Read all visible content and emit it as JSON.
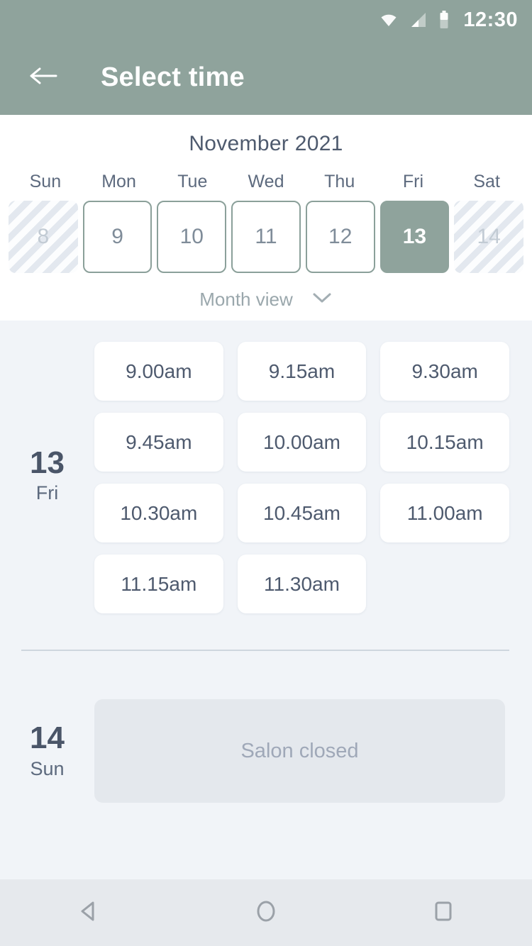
{
  "statusbar": {
    "time": "12:30",
    "icons": [
      "wifi-icon",
      "cellular-signal-icon",
      "battery-icon"
    ]
  },
  "appbar": {
    "back_icon": "back-arrow-icon",
    "title": "Select time"
  },
  "calendar": {
    "month_title": "November 2021",
    "weekdays": [
      "Sun",
      "Mon",
      "Tue",
      "Wed",
      "Thu",
      "Fri",
      "Sat"
    ],
    "days": [
      {
        "label": "8",
        "state": "disabled"
      },
      {
        "label": "9",
        "state": "available"
      },
      {
        "label": "10",
        "state": "available"
      },
      {
        "label": "11",
        "state": "available"
      },
      {
        "label": "12",
        "state": "available"
      },
      {
        "label": "13",
        "state": "selected"
      },
      {
        "label": "14",
        "state": "disabled"
      }
    ],
    "view_toggle": {
      "label": "Month view",
      "icon": "chevron-down-icon"
    }
  },
  "schedule": {
    "days": [
      {
        "date_number": "13",
        "weekday": "Fri",
        "slots": [
          "9.00am",
          "9.15am",
          "9.30am",
          "9.45am",
          "10.00am",
          "10.15am",
          "10.30am",
          "10.45am",
          "11.00am",
          "11.15am",
          "11.30am"
        ]
      },
      {
        "date_number": "14",
        "weekday": "Sun",
        "closed_message": "Salon closed"
      }
    ]
  },
  "navbar": {
    "back": "nav-back-icon",
    "home": "nav-home-icon",
    "recents": "nav-recents-icon"
  },
  "colors": {
    "accent": "#8fa39c",
    "appbar": "#8fa39c",
    "page_bg": "#f1f4f8",
    "text_dark": "#4e5a6e",
    "text_muted": "#9aa7ac",
    "closed_bg": "#e4e8ed"
  }
}
